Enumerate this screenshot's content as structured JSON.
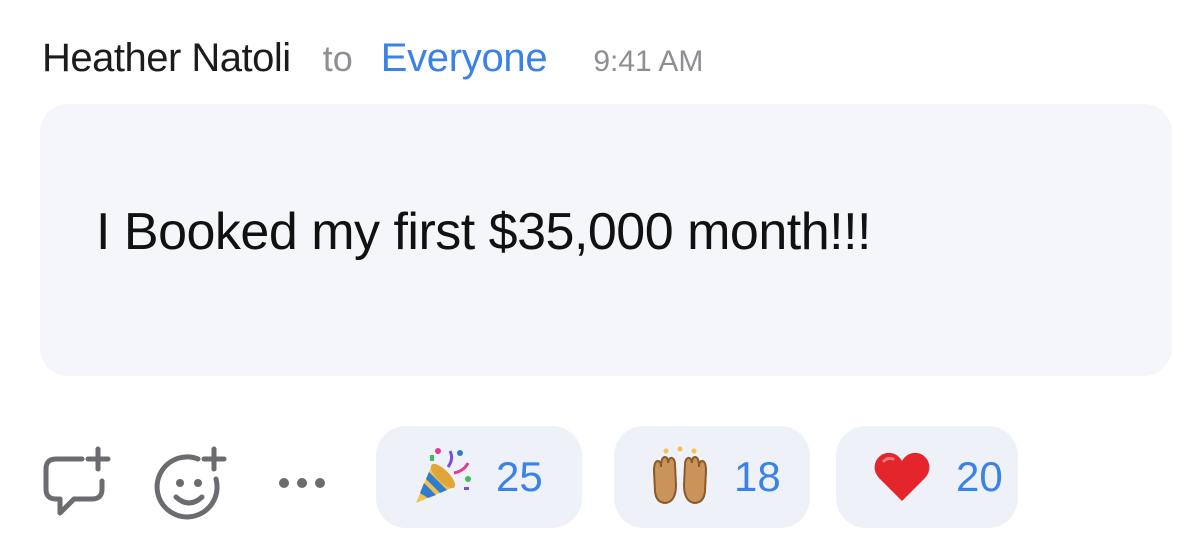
{
  "post": {
    "sender": "Heather Natoli",
    "to_word": "to",
    "recipient": "Everyone",
    "time": "9:41 AM",
    "message": "I Booked my first $35,000 month!!!"
  },
  "actions": {
    "reply_icon": "comment-plus-icon",
    "add_reaction_icon": "smiley-plus-icon",
    "more_icon": "ellipsis-icon"
  },
  "reactions": [
    {
      "emoji": "party-popper-icon",
      "count": "25"
    },
    {
      "emoji": "raising-hands-icon",
      "count": "18"
    },
    {
      "emoji": "red-heart-icon",
      "count": "20"
    }
  ],
  "colors": {
    "accent": "#3b82e6",
    "bubble": "#f5f6fa",
    "reaction_bg": "#eef1f7",
    "muted": "#8e8e93",
    "heart": "#e4252c"
  }
}
